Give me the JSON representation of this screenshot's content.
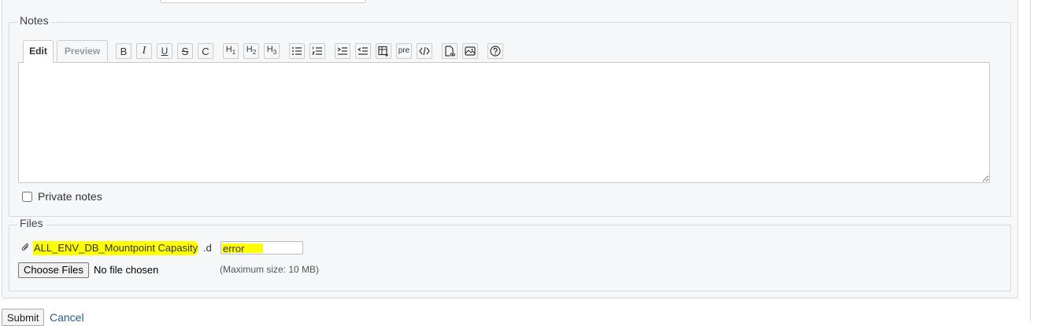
{
  "notes": {
    "legend": "Notes",
    "tabs": {
      "edit": "Edit",
      "preview": "Preview"
    },
    "toolbar": [
      {
        "name": "bold-icon",
        "glyph": "B"
      },
      {
        "name": "italic-icon",
        "glyph": "I"
      },
      {
        "name": "underline-icon",
        "glyph": "U"
      },
      {
        "name": "strikethrough-icon",
        "glyph": "S"
      },
      {
        "name": "inline-code-icon",
        "glyph": "C"
      },
      {
        "name": "heading-1-icon",
        "glyph": "H1"
      },
      {
        "name": "heading-2-icon",
        "glyph": "H2"
      },
      {
        "name": "heading-3-icon",
        "glyph": "H3"
      },
      {
        "name": "unordered-list-icon",
        "glyph": "ul"
      },
      {
        "name": "ordered-list-icon",
        "glyph": "ol"
      },
      {
        "name": "indent-icon",
        "glyph": "indent"
      },
      {
        "name": "outdent-icon",
        "glyph": "outdent"
      },
      {
        "name": "table-icon",
        "glyph": "table"
      },
      {
        "name": "pre-icon",
        "glyph": "pre"
      },
      {
        "name": "code-block-icon",
        "glyph": "</>"
      },
      {
        "name": "wiki-page-link-icon",
        "glyph": "page"
      },
      {
        "name": "image-icon",
        "glyph": "image"
      },
      {
        "name": "help-icon",
        "glyph": "?"
      }
    ],
    "text_value": "",
    "private_label": "Private notes",
    "private_checked": false
  },
  "files": {
    "legend": "Files",
    "attachment_name": "ALL_ENV_DB_Mountpoint Capasity",
    "attachment_ext": ".d",
    "description_value": "error",
    "choose_label": "Choose Files",
    "no_file_text": "No file chosen",
    "max_size_text": "(Maximum size: 10 MB)"
  },
  "actions": {
    "submit": "Submit",
    "cancel": "Cancel"
  },
  "colors": {
    "highlight": "#ffff00",
    "link": "#2a5d8e"
  }
}
